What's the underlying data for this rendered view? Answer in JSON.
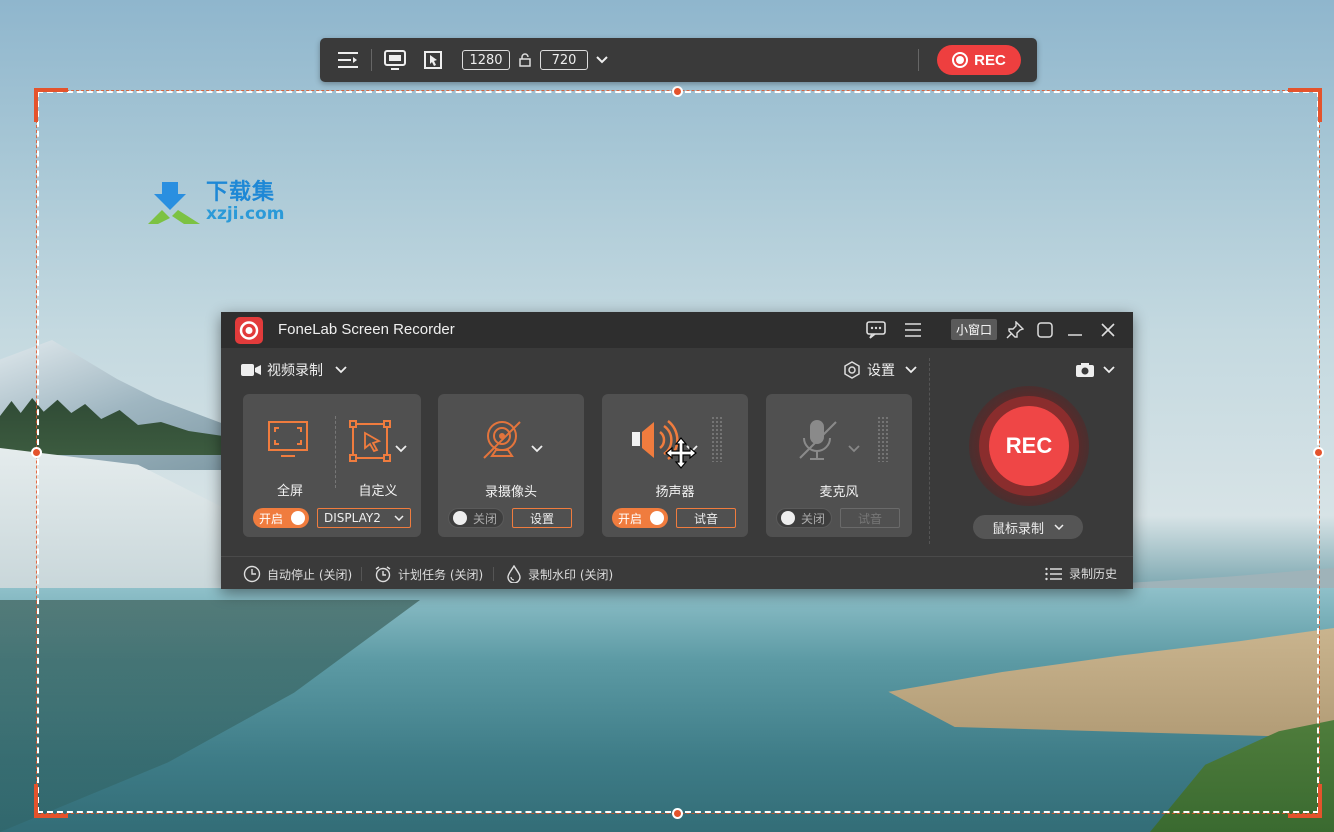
{
  "toolbar": {
    "width_value": "1280",
    "height_value": "720",
    "rec_label": "REC"
  },
  "watermark": {
    "cn": "下载集",
    "en": "xzji.com"
  },
  "window": {
    "title": "FoneLab Screen Recorder",
    "mini_window_label": "小窗口",
    "mode_label": "视频录制",
    "settings_label": "设置",
    "rec_label": "REC",
    "mouse_record_label": "鼠标录制",
    "cards": {
      "display": {
        "fullscreen_label": "全屏",
        "custom_label": "自定义",
        "toggle_label": "开启",
        "display_select": "DISPLAY2"
      },
      "camera": {
        "label": "录摄像头",
        "toggle_label": "关闭",
        "settings_button": "设置"
      },
      "speaker": {
        "label": "扬声器",
        "toggle_label": "开启",
        "test_button": "试音"
      },
      "mic": {
        "label": "麦克风",
        "toggle_label": "关闭",
        "test_button": "试音"
      }
    },
    "bottom": {
      "auto_stop": "自动停止 (关闭)",
      "schedule": "计划任务 (关闭)",
      "watermark": "录制水印 (关闭)",
      "history": "录制历史"
    }
  },
  "colors": {
    "accent": "#f07c3e",
    "rec_red": "#ef4646",
    "selection": "#e4532c"
  }
}
